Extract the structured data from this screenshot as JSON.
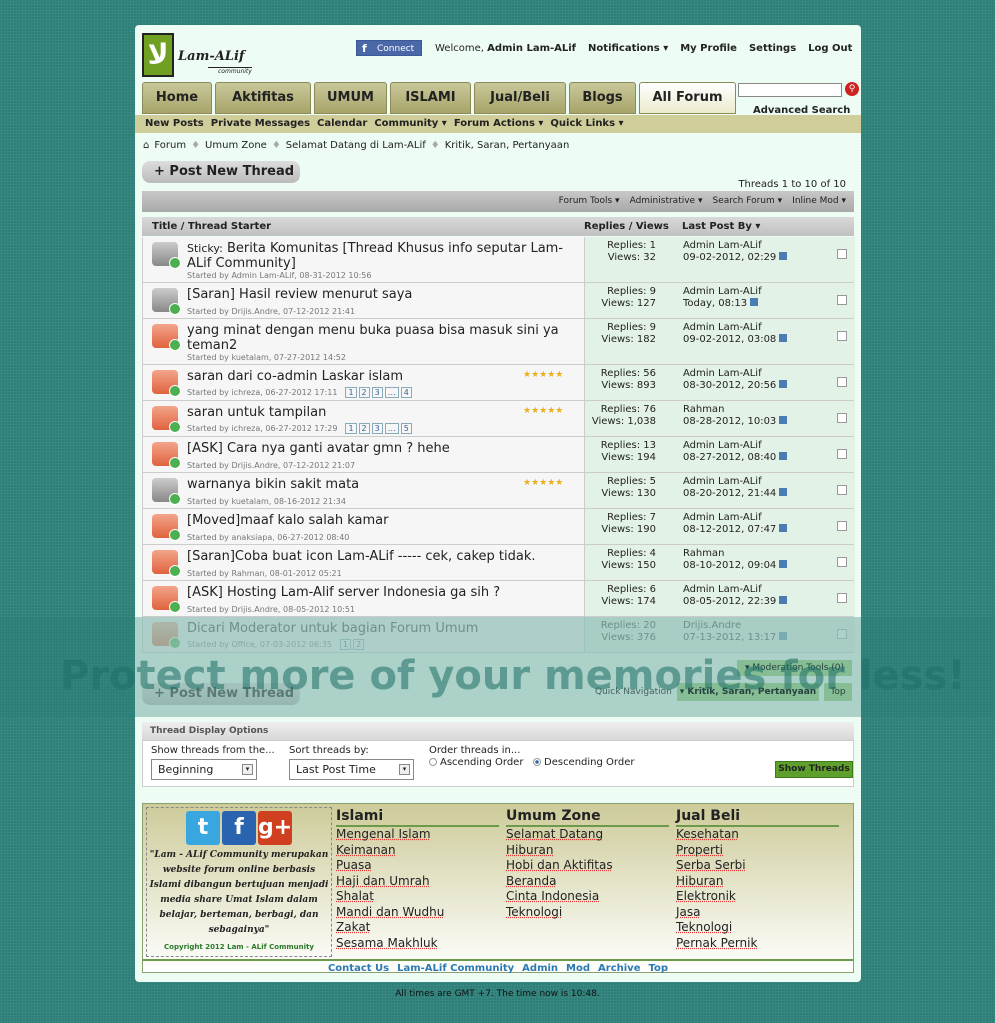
{
  "header": {
    "logo_text": "Lam-ALif",
    "logo_sub": "community",
    "fb_connect": "Connect",
    "welcome": "Welcome,",
    "user": "Admin Lam-ALif",
    "links": [
      "Notifications ▾",
      "My Profile",
      "Settings",
      "Log Out"
    ],
    "advanced_search": "Advanced Search"
  },
  "tabs": [
    {
      "label": "Home",
      "w": 70
    },
    {
      "label": "Aktifitas",
      "w": 96
    },
    {
      "label": "UMUM",
      "w": 73
    },
    {
      "label": "ISLAMI",
      "w": 81
    },
    {
      "label": "Jual/Beli",
      "w": 92
    },
    {
      "label": "Blogs",
      "w": 67
    },
    {
      "label": "All Forum",
      "w": 97
    }
  ],
  "navbar": [
    "New Posts",
    "Private Messages",
    "Calendar",
    "Community ▾",
    "Forum Actions ▾",
    "Quick Links ▾"
  ],
  "breadcrumb": [
    "Forum",
    "Umum Zone",
    "Selamat Datang di Lam-ALif",
    "Kritik, Saran, Pertanyaan"
  ],
  "post_new_thread": "+ Post New Thread",
  "thread_count": "Threads 1 to 10 of 10",
  "toolbar": [
    "Forum Tools ▾",
    "Administrative ▾",
    "Search Forum ▾",
    "Inline Mod ▾"
  ],
  "columns": {
    "title": "Title / Thread Starter",
    "replies": "Replies / Views",
    "lastpost": "Last Post By ▾"
  },
  "threads": [
    {
      "prefix": "Sticky:",
      "title": "Berita Komunitas [Thread Khusus info seputar Lam-ALif Community]",
      "starter": "Started by Admin Lam-ALif, 08-31-2012 10:56",
      "replies": "Replies: 1",
      "views": "Views: 32",
      "last_by": "Admin Lam-ALif",
      "last_date": "09-02-2012, 02:29",
      "icon": "grey",
      "tall": true
    },
    {
      "title": "[Saran] Hasil review menurut saya",
      "starter": "Started by Drijis.Andre, 07-12-2012 21:41",
      "replies": "Replies: 9",
      "views": "Views: 127",
      "last_by": "Admin Lam-ALif",
      "last_date": "Today, 08:13",
      "icon": "grey"
    },
    {
      "title": "yang minat dengan menu buka puasa bisa masuk sini ya teman2",
      "starter": "Started by kuetalam, 07-27-2012 14:52",
      "replies": "Replies: 9",
      "views": "Views: 182",
      "last_by": "Admin Lam-ALif",
      "last_date": "09-02-2012, 03:08",
      "icon": "hot",
      "tall": true
    },
    {
      "title": "saran dari co-admin Laskar islam",
      "starter": "Started by ichreza, 06-27-2012 17:11",
      "pages": [
        "1",
        "2",
        "3",
        "…",
        "4"
      ],
      "rating": "★★★★★",
      "replies": "Replies: 56",
      "views": "Views: 893",
      "last_by": "Admin Lam-ALif",
      "last_date": "08-30-2012, 20:56",
      "icon": "hot"
    },
    {
      "title": "saran untuk tampilan",
      "starter": "Started by ichreza, 06-27-2012 17:29",
      "pages": [
        "1",
        "2",
        "3",
        "…",
        "5"
      ],
      "rating": "★★★★★",
      "replies": "Replies: 76",
      "views": "Views: 1,038",
      "last_by": "Rahman",
      "last_date": "08-28-2012, 10:03",
      "icon": "hot"
    },
    {
      "title": "[ASK] Cara nya ganti avatar gmn ? hehe",
      "starter": "Started by Drijis.Andre, 07-12-2012 21:07",
      "replies": "Replies: 13",
      "views": "Views: 194",
      "last_by": "Admin Lam-ALif",
      "last_date": "08-27-2012, 08:40",
      "icon": "hot"
    },
    {
      "title": "warnanya bikin sakit mata",
      "starter": "Started by kuetalam, 08-16-2012 21:34",
      "rating": "★★★★★",
      "replies": "Replies: 5",
      "views": "Views: 130",
      "last_by": "Admin Lam-ALif",
      "last_date": "08-20-2012, 21:44",
      "icon": "grey"
    },
    {
      "title": "[Moved]maaf kalo salah kamar",
      "starter": "Started by anaksiapa, 06-27-2012 08:40",
      "replies": "Replies: 7",
      "views": "Views: 190",
      "last_by": "Admin Lam-ALif",
      "last_date": "08-12-2012, 07:47",
      "icon": "hot"
    },
    {
      "title": "[Saran]Coba buat icon Lam-ALif ----- cek, cakep tidak.",
      "starter": "Started by Rahman, 08-01-2012 05:21",
      "replies": "Replies: 4",
      "views": "Views: 150",
      "last_by": "Rahman",
      "last_date": "08-10-2012, 09:04",
      "icon": "hot"
    },
    {
      "title": "[ASK] Hosting Lam-Alif server Indonesia ga sih ?",
      "starter": "Started by Drijis.Andre, 08-05-2012 10:51",
      "replies": "Replies: 6",
      "views": "Views: 174",
      "last_by": "Admin Lam-ALif",
      "last_date": "08-05-2012, 22:39",
      "icon": "hot"
    },
    {
      "title": "Dicari Moderator untuk bagian Forum Umum",
      "starter": "Started by Office, 07-03-2012 06:35",
      "pages": [
        "1",
        "2"
      ],
      "replies": "Replies: 20",
      "views": "Views: 376",
      "last_by": "Drijis.Andre",
      "last_date": "07-13-2012, 13:17",
      "icon": "hot",
      "faded": true
    }
  ],
  "moderation_tools": "▾ Moderation Tools (0)",
  "quick_nav": {
    "label": "Quick Navigation",
    "selected": "▾ Kritik, Saran, Pertanyaan",
    "top": "Top"
  },
  "display_options": {
    "title": "Thread Display Options",
    "show_from_label": "Show threads from the...",
    "show_from": "Beginning",
    "sort_label": "Sort threads by:",
    "sort": "Last Post Time",
    "order_label": "Order threads in...",
    "asc": "Ascending Order",
    "desc": "Descending Order",
    "button": "Show Threads"
  },
  "footer": {
    "quote": "\"Lam - ALif Community merupakan website forum online berbasis Islami dibangun bertujuan menjadi media share Umat Islam dalam belajar, berteman, berbagi, dan sebagainya\"",
    "copyright": "Copyright 2012 Lam - ALif Community",
    "columns": [
      {
        "title": "Islami",
        "items": [
          "Mengenal Islam",
          "Keimanan",
          "Puasa",
          "Haji dan Umrah",
          "Shalat",
          "Mandi dan Wudhu",
          "Zakat",
          "Sesama Makhluk"
        ]
      },
      {
        "title": "Umum Zone",
        "items": [
          "Selamat Datang",
          "Hiburan",
          "Hobi dan Aktifitas",
          "Beranda",
          "Cinta Indonesia",
          "Teknologi"
        ]
      },
      {
        "title": "Jual Beli",
        "items": [
          "Kesehatan",
          "Properti",
          "Serba Serbi",
          "Hiburan",
          "Elektronik",
          "Jasa",
          "Teknologi",
          "Pernak Pernik"
        ]
      }
    ],
    "links": [
      "Contact Us",
      "Lam-ALif Community",
      "Admin",
      "Mod",
      "Archive",
      "Top"
    ]
  },
  "time_note": "All times are GMT +7. The time now is 10:48.",
  "watermark": "Protect more of your memories for less!"
}
